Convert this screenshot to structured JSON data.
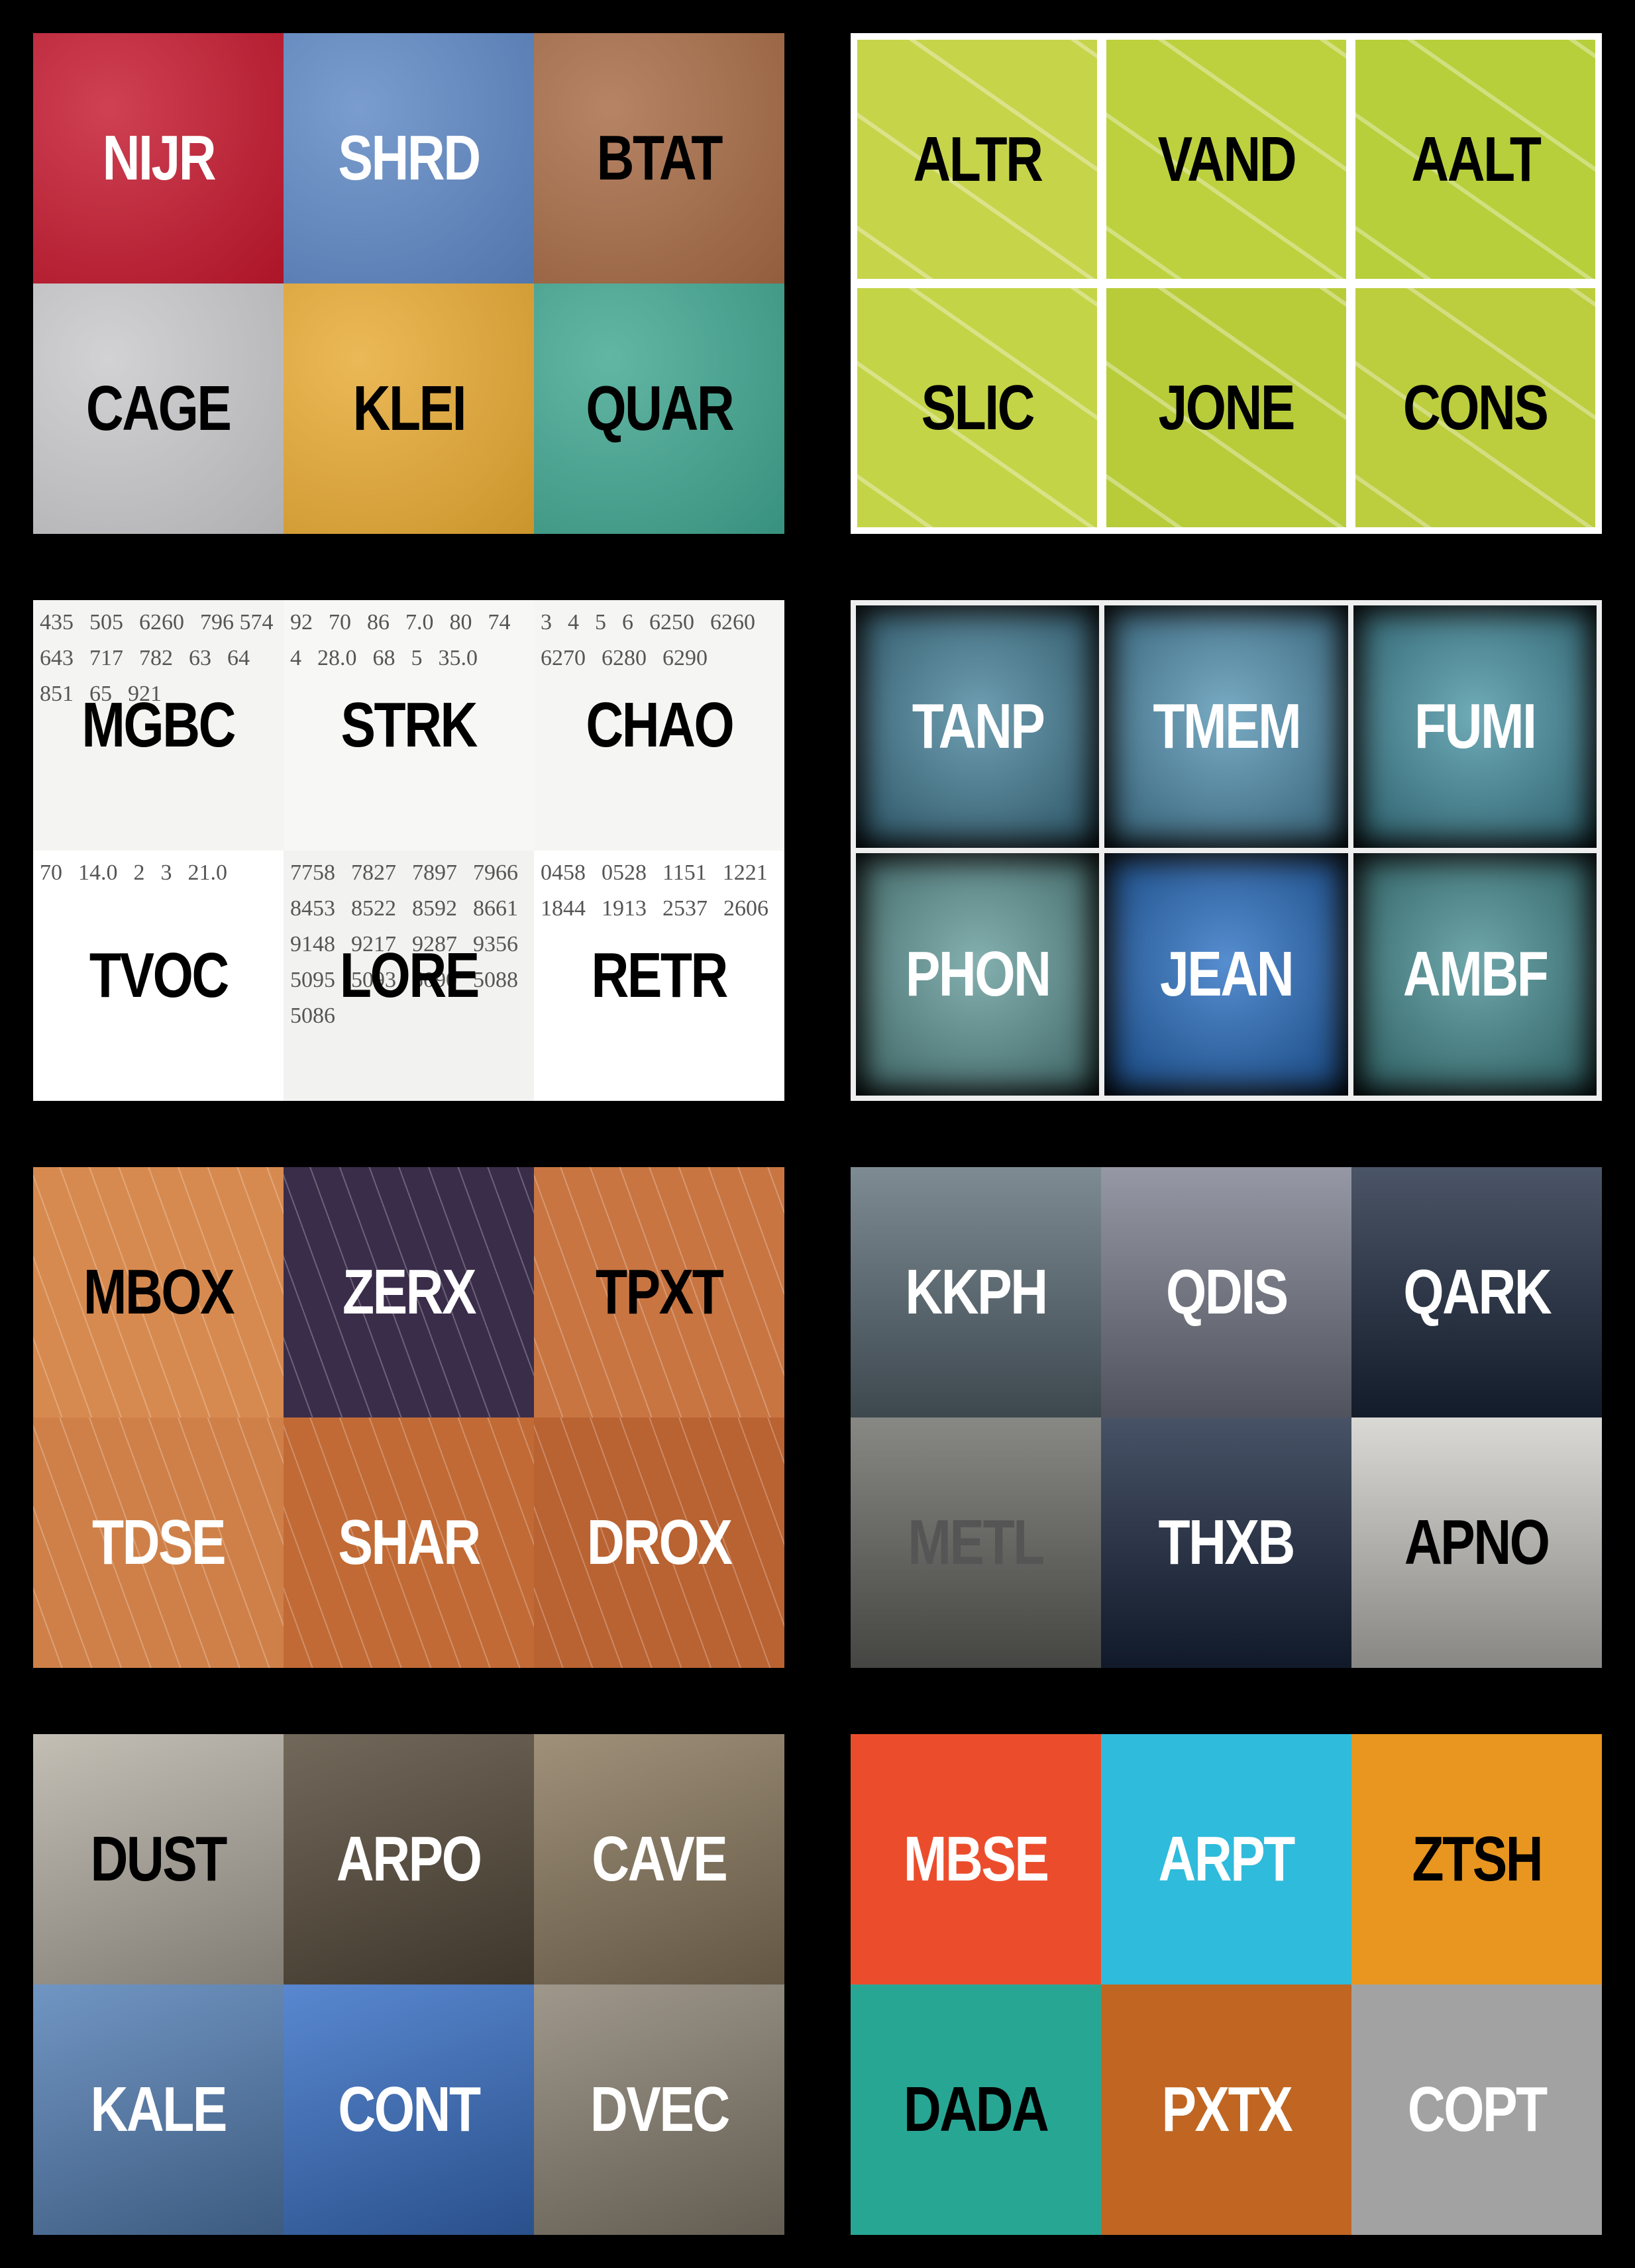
{
  "panels": [
    {
      "id": "texture-panel",
      "tiles": [
        {
          "code": "NIJR",
          "bg": "#c4172d",
          "text": "#ffffff"
        },
        {
          "code": "SHRD",
          "bg": "#5d87c4",
          "text": "#ffffff"
        },
        {
          "code": "BTAT",
          "bg": "#a66a44",
          "text": "#000000"
        },
        {
          "code": "CAGE",
          "bg": "#c8c8ca",
          "text": "#000000"
        },
        {
          "code": "KLEI",
          "bg": "#e7a932",
          "text": "#000000"
        },
        {
          "code": "QUAR",
          "bg": "#3fa58f",
          "text": "#000000"
        }
      ]
    },
    {
      "id": "field-panel",
      "tiles": [
        {
          "code": "ALTR",
          "bg": "#c6d44a",
          "text": "#000000"
        },
        {
          "code": "VAND",
          "bg": "#bdd13e",
          "text": "#000000"
        },
        {
          "code": "AALT",
          "bg": "#b7cf3b",
          "text": "#000000"
        },
        {
          "code": "SLIC",
          "bg": "#c4d447",
          "text": "#000000"
        },
        {
          "code": "JONE",
          "bg": "#b8cc3a",
          "text": "#000000"
        },
        {
          "code": "CONS",
          "bg": "#bccd3e",
          "text": "#000000"
        }
      ]
    },
    {
      "id": "numbers-panel",
      "tiles": [
        {
          "code": "MGBC",
          "bg": "#f4f4f2",
          "text": "#000000",
          "digits": [
            "435",
            "505",
            "6260",
            "796 574",
            "643",
            "717",
            "782",
            "63",
            "64",
            "851",
            "65",
            "921"
          ]
        },
        {
          "code": "STRK",
          "bg": "#f7f7f5",
          "text": "#000000",
          "digits": [
            "92",
            "70",
            "86",
            "7.0",
            "80",
            "74",
            "4",
            "28.0",
            "68",
            "5",
            "35.0"
          ]
        },
        {
          "code": "CHAO",
          "bg": "#f5f5f3",
          "text": "#000000",
          "digits": [
            "3",
            "4",
            "5",
            "6",
            "6250",
            "6260",
            "6270",
            "6280",
            "6290"
          ]
        },
        {
          "code": "TVOC",
          "bg": "#ffffff",
          "text": "#000000",
          "digits": [
            "70",
            "14.0",
            "2",
            "3",
            "21.0"
          ]
        },
        {
          "code": "LORE",
          "bg": "#f2f2f0",
          "text": "#000000",
          "digits": [
            "7758",
            "7827",
            "7897",
            "7966",
            "8453",
            "8522",
            "8592",
            "8661",
            "9148",
            "9217",
            "9287",
            "9356",
            "5095",
            "5093",
            "5090",
            "5088",
            "5086"
          ]
        },
        {
          "code": "RETR",
          "bg": "#ffffff",
          "text": "#000000",
          "digits": [
            "0458",
            "0528",
            "1151",
            "1221",
            "1844",
            "1913",
            "2537",
            "2606"
          ]
        }
      ]
    },
    {
      "id": "photo-blue-panel",
      "tiles": [
        {
          "code": "TANP",
          "bg": "#3f7e98",
          "text": "#ffffff"
        },
        {
          "code": "TMEM",
          "bg": "#4c8fb0",
          "text": "#ffffff"
        },
        {
          "code": "FUMI",
          "bg": "#3f8ea0",
          "text": "#ffffff"
        },
        {
          "code": "PHON",
          "bg": "#5c9696",
          "text": "#ffffff"
        },
        {
          "code": "JEAN",
          "bg": "#1e68c0",
          "text": "#ffffff"
        },
        {
          "code": "AMBF",
          "bg": "#3f8a8f",
          "text": "#ffffff"
        }
      ]
    },
    {
      "id": "collage-panel",
      "tiles": [
        {
          "code": "MBOX",
          "bg": "#d78a4f",
          "text": "#000000"
        },
        {
          "code": "ZERX",
          "bg": "#3a2d4a",
          "text": "#ffffff"
        },
        {
          "code": "TPXT",
          "bg": "#c87542",
          "text": "#000000"
        },
        {
          "code": "TDSE",
          "bg": "#cf8048",
          "text": "#ffffff"
        },
        {
          "code": "SHAR",
          "bg": "#c16a35",
          "text": "#ffffff"
        },
        {
          "code": "DROX",
          "bg": "#b96232",
          "text": "#ffffff"
        }
      ]
    },
    {
      "id": "landscape-panel",
      "tiles": [
        {
          "code": "KKPH",
          "bg": "#5d6e78",
          "text": "#ffffff"
        },
        {
          "code": "QDIS",
          "bg": "#7b7f8e",
          "text": "#ffffff"
        },
        {
          "code": "QARK",
          "bg": "#1d2a40",
          "text": "#ffffff"
        },
        {
          "code": "METL",
          "bg": "#6a6a66",
          "text": "#555555"
        },
        {
          "code": "THXB",
          "bg": "#1a2740",
          "text": "#ffffff"
        },
        {
          "code": "APNO",
          "bg": "#d0cfca",
          "text": "#000000"
        }
      ]
    },
    {
      "id": "travel-panel",
      "tiles": [
        {
          "code": "DUST",
          "bg": "#b9b3a8",
          "text": "#000000"
        },
        {
          "code": "ARPO",
          "bg": "#5a4e3e",
          "text": "#ffffff"
        },
        {
          "code": "CAVE",
          "bg": "#8e7d62",
          "text": "#ffffff"
        },
        {
          "code": "KALE",
          "bg": "#5883b8",
          "text": "#ffffff"
        },
        {
          "code": "CONT",
          "bg": "#3c73c8",
          "text": "#ffffff"
        },
        {
          "code": "DVEC",
          "bg": "#8e8576",
          "text": "#ffffff"
        }
      ]
    },
    {
      "id": "symbols-panel",
      "tiles": [
        {
          "code": "MBSE",
          "bg": "#eb4d2c",
          "text": "#ffffff"
        },
        {
          "code": "ARPT",
          "bg": "#2fbbdc",
          "text": "#ffffff"
        },
        {
          "code": "ZTSH",
          "bg": "#e8961f",
          "text": "#000000"
        },
        {
          "code": "DADA",
          "bg": "#28a694",
          "text": "#000000"
        },
        {
          "code": "PXTX",
          "bg": "#c06622",
          "text": "#ffffff"
        },
        {
          "code": "COPT",
          "bg": "#a2a2a2",
          "text": "#ffffff"
        }
      ]
    }
  ]
}
